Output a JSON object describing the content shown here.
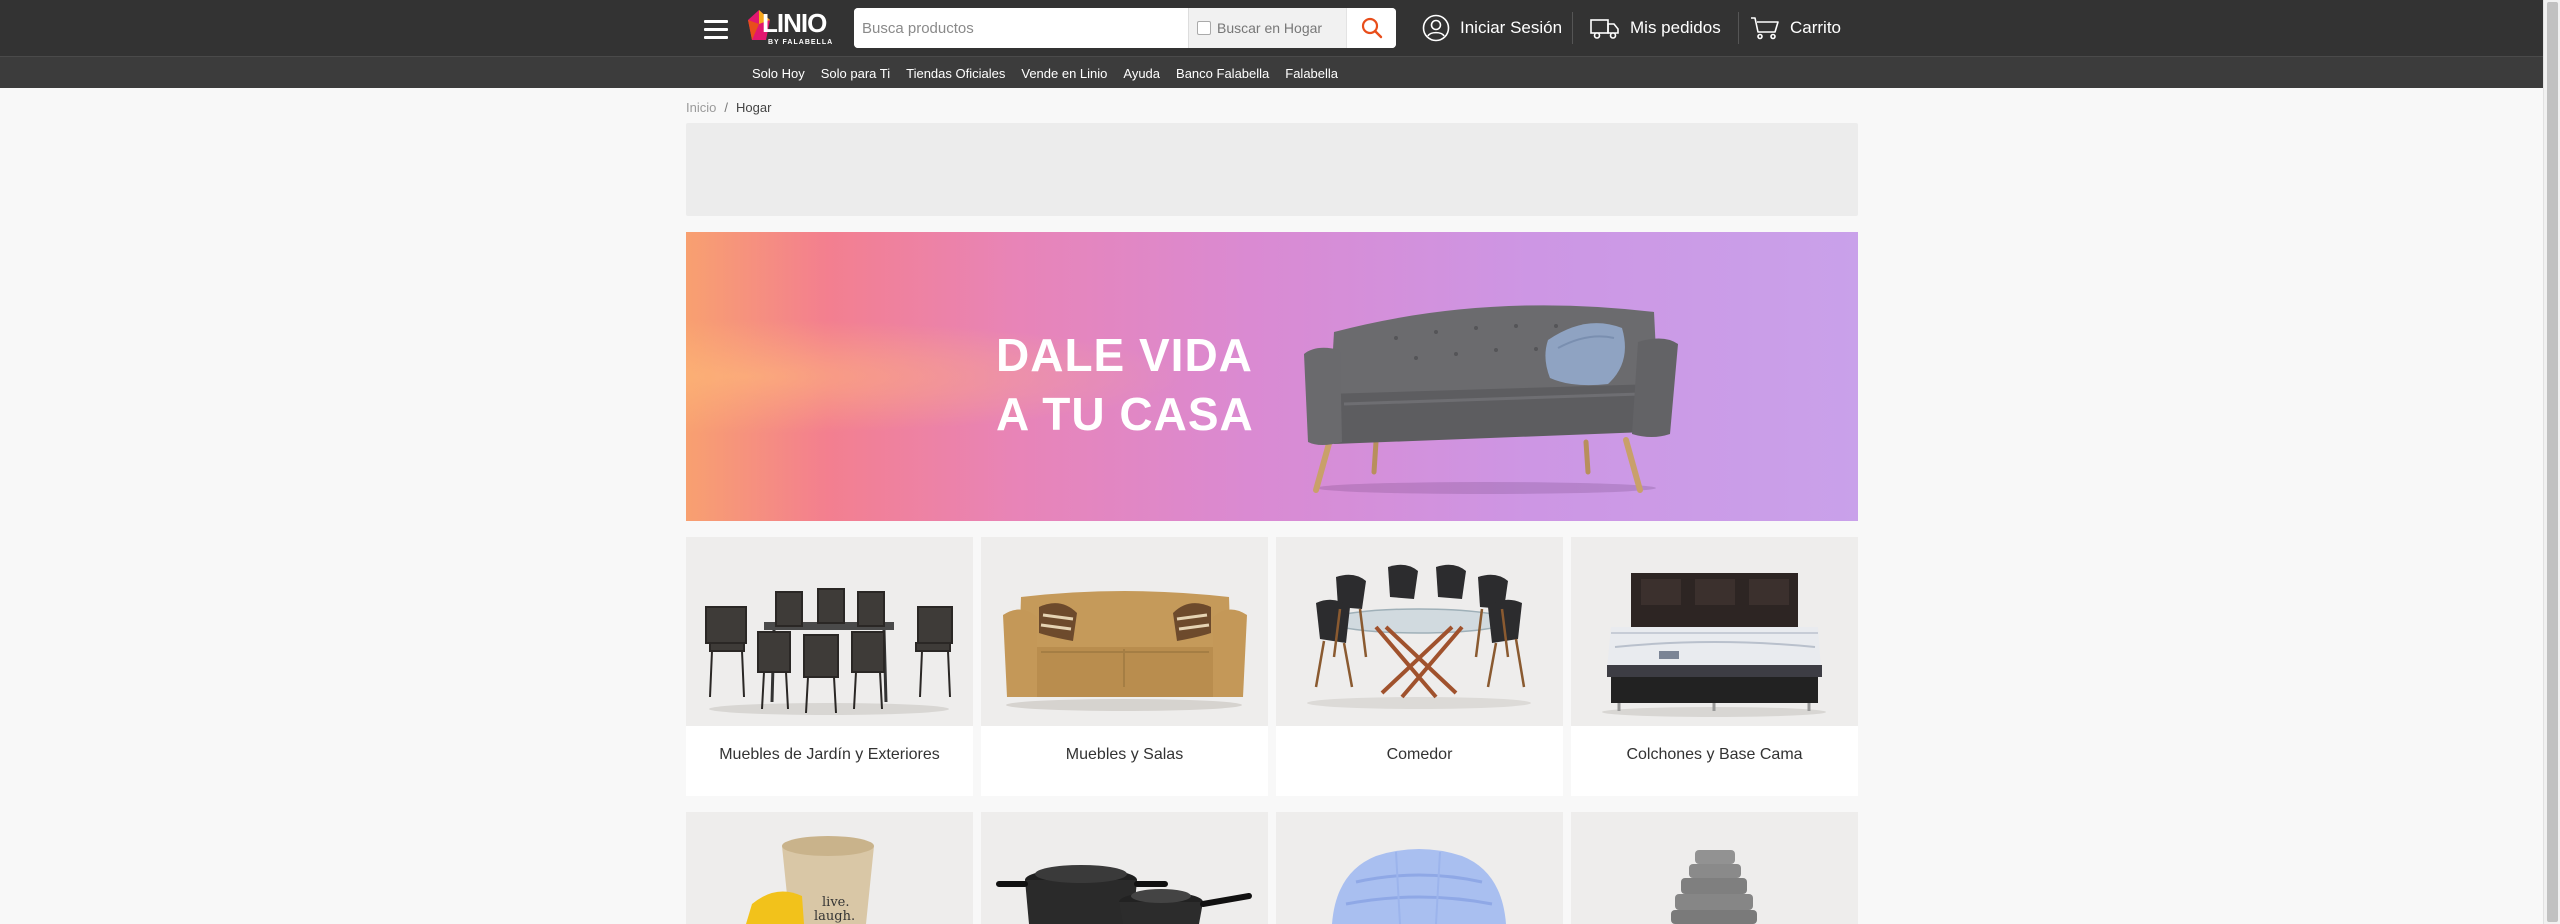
{
  "header": {
    "logo_text": "LINIO",
    "logo_subtext": "BY FALABELLA",
    "search": {
      "placeholder": "Busca productos",
      "filter_label": "Buscar en Hogar"
    },
    "login_label": "Iniciar Sesión",
    "orders_label": "Mis pedidos",
    "cart_label": "Carrito"
  },
  "subnav": {
    "items": [
      {
        "label": "Solo Hoy"
      },
      {
        "label": "Solo para Ti"
      },
      {
        "label": "Tiendas Oficiales"
      },
      {
        "label": "Vende en Linio"
      },
      {
        "label": "Ayuda"
      },
      {
        "label": "Banco Falabella"
      },
      {
        "label": "Falabella"
      }
    ]
  },
  "breadcrumb": {
    "home": "Inicio",
    "separator": "/",
    "current": "Hogar"
  },
  "hero": {
    "line1": "DALE VIDA",
    "line2": "A TU CASA"
  },
  "categories": [
    {
      "label": "Muebles de Jardín y Exteriores",
      "icon": "patio-dining-set"
    },
    {
      "label": "Muebles y Salas",
      "icon": "sofa"
    },
    {
      "label": "Comedor",
      "icon": "dining-table"
    },
    {
      "label": "Colchones y Base Cama",
      "icon": "bed"
    },
    {
      "label": "",
      "icon": "storage-basket"
    },
    {
      "label": "",
      "icon": "cookware"
    },
    {
      "label": "",
      "icon": "bedding"
    },
    {
      "label": "",
      "icon": "towels"
    }
  ],
  "colors": {
    "header_bg": "#333333",
    "subnav_bg": "#3c3c3c",
    "accent": "#e84e1b",
    "page_bg": "#f8f8f8"
  }
}
